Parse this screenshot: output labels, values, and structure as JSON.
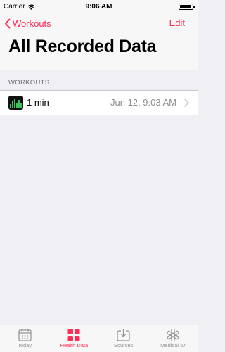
{
  "status_bar": {
    "carrier": "Carrier",
    "time": "9:06 AM",
    "battery_level": 0.95
  },
  "nav": {
    "back_label": "Workouts",
    "edit_label": "Edit",
    "title": "All Recorded Data"
  },
  "section": {
    "header": "WORKOUTS"
  },
  "rows": [
    {
      "title": "1 min",
      "date": "Jun 12, 9:03 AM",
      "icon": "workout-chart-icon"
    }
  ],
  "tabs": [
    {
      "label": "Today",
      "icon": "calendar-icon",
      "active": false
    },
    {
      "label": "Health Data",
      "icon": "grid-icon",
      "active": true
    },
    {
      "label": "Sources",
      "icon": "download-heart-icon",
      "active": false
    },
    {
      "label": "Medical ID",
      "icon": "asterisk-icon",
      "active": false
    }
  ],
  "colors": {
    "accent": "#ff2d55",
    "background": "#efeff4",
    "inactive_tab": "#929292"
  }
}
